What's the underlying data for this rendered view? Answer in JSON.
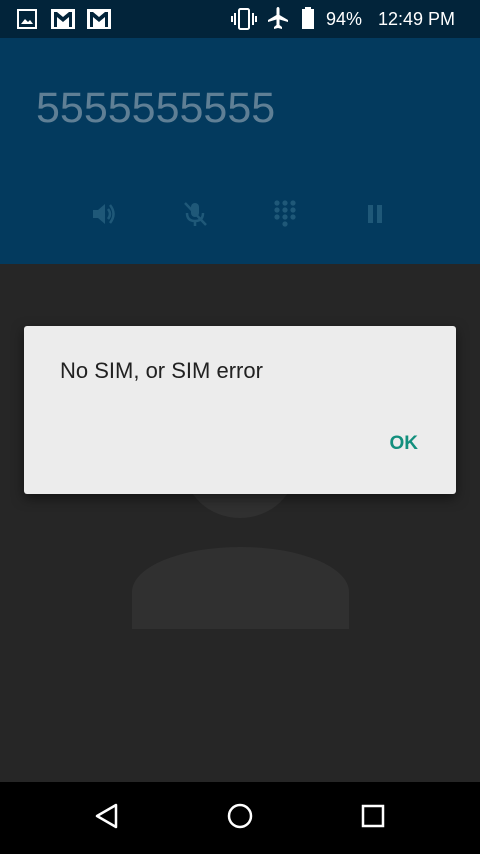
{
  "status_bar": {
    "notification_icons": [
      "gallery-icon",
      "gmail-icon",
      "gmail-icon"
    ],
    "system_icons": [
      "vibrate-icon",
      "airplane-mode-icon",
      "battery-icon"
    ],
    "battery_percent": "94%",
    "time": "12:49 PM"
  },
  "call": {
    "number": "5555555555",
    "controls": [
      "speaker-icon",
      "mute-mic-icon",
      "dialpad-icon",
      "pause-icon"
    ]
  },
  "dialog": {
    "message": "No SIM, or SIM error",
    "ok_label": "OK"
  },
  "navigation": {
    "buttons": [
      "back-icon",
      "home-icon",
      "recents-icon"
    ]
  },
  "colors": {
    "status_bar": "#02243a",
    "call_header": "#033a5e",
    "call_body": "#262626",
    "dialog_bg": "#ececec",
    "accent": "#128f7d"
  }
}
